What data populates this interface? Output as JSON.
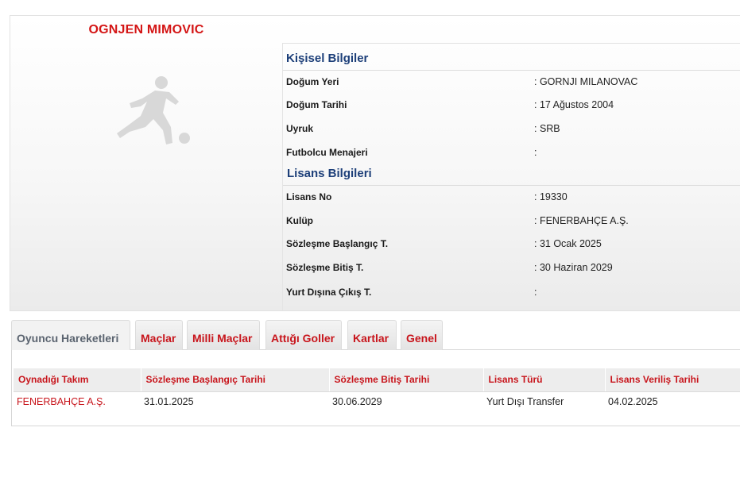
{
  "player": {
    "name": "OGNJEN MIMOVIC",
    "photo_icon": "player-silhouette-icon"
  },
  "personal": {
    "title": "Kişisel Bilgiler",
    "rows": [
      {
        "label": "Doğum Yeri",
        "value": ":  GORNJI MILANOVAC"
      },
      {
        "label": "Doğum Tarihi",
        "value": ":  17 Ağustos 2004"
      },
      {
        "label": "Uyruk",
        "value": ":  SRB"
      },
      {
        "label": "Futbolcu Menajeri",
        "value": ":"
      }
    ]
  },
  "license": {
    "title": "Lisans Bilgileri",
    "rows": [
      {
        "label": "Lisans No",
        "value": ": 19330"
      },
      {
        "label": "Kulüp",
        "value": ": FENERBAHÇE A.Ş."
      },
      {
        "label": "Sözleşme Başlangıç T.",
        "value": ": 31 Ocak 2025"
      },
      {
        "label": "Sözleşme Bitiş T.",
        "value": ": 30 Haziran 2029"
      },
      {
        "label": "Yurt Dışına Çıkış T.",
        "value": ":"
      }
    ]
  },
  "tabs": [
    {
      "label": "Oyuncu Hareketleri",
      "active": true
    },
    {
      "label": "Maçlar",
      "active": false
    },
    {
      "label": "Milli Maçlar",
      "active": false
    },
    {
      "label": "Attığı Goller",
      "active": false
    },
    {
      "label": "Kartlar",
      "active": false
    },
    {
      "label": "Genel",
      "active": false
    }
  ],
  "history": {
    "columns": [
      "Oynadığı Takım",
      "Sözleşme Başlangıç Tarihi",
      "Sözleşme Bitiş Tarihi",
      "Lisans Türü",
      "Lisans Veriliş Tarihi"
    ],
    "rows": [
      [
        "FENERBAHÇE A.Ş.",
        "31.01.2025",
        "30.06.2029",
        "Yurt Dışı Transfer",
        "04.02.2025"
      ]
    ]
  },
  "colors": {
    "accent_red": "#c8151c",
    "section_blue": "#1d3f79",
    "name_red": "#d41515"
  }
}
